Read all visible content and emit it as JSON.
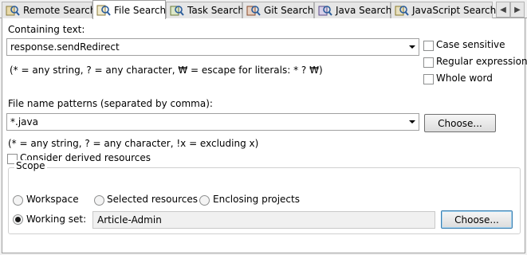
{
  "tabs": [
    {
      "label": "Remote Search",
      "icon": "search-icon",
      "active": false
    },
    {
      "label": "File Search",
      "icon": "file-search-icon",
      "active": true
    },
    {
      "label": "Task Search",
      "icon": "task-search-icon",
      "active": false
    },
    {
      "label": "Git Search",
      "icon": "git-search-icon",
      "active": false
    },
    {
      "label": "Java Search",
      "icon": "java-search-icon",
      "active": false
    },
    {
      "label": "JavaScript Search",
      "icon": "javascript-search-icon",
      "active": false
    }
  ],
  "containing_text": {
    "label": "Containing text:",
    "value": "response.sendRedirect",
    "hint": "(* = any string, ? = any character, ₩ = escape for literals: * ? ₩)"
  },
  "options": {
    "case_sensitive": {
      "label": "Case sensitive",
      "checked": false
    },
    "regular_expression": {
      "label": "Regular expression",
      "checked": false
    },
    "whole_word": {
      "label": "Whole word",
      "checked": false
    }
  },
  "file_name_patterns": {
    "label": "File name patterns (separated by comma):",
    "value": "*.java",
    "hint": "(* = any string, ? = any character, !x = excluding x)",
    "choose_label": "Choose..."
  },
  "derived": {
    "label": "Consider derived resources",
    "checked": false
  },
  "scope": {
    "legend": "Scope",
    "workspace_label": "Workspace",
    "selected_resources_label": "Selected resources",
    "enclosing_projects_label": "Enclosing projects",
    "working_set_label": "Working set:",
    "working_set_value": "Article-Admin",
    "selected": "working_set",
    "choose_label": "Choose..."
  },
  "colors": {
    "accent": "#3c7fb1",
    "panel": "#ffffff",
    "background": "#f0f0f0"
  }
}
